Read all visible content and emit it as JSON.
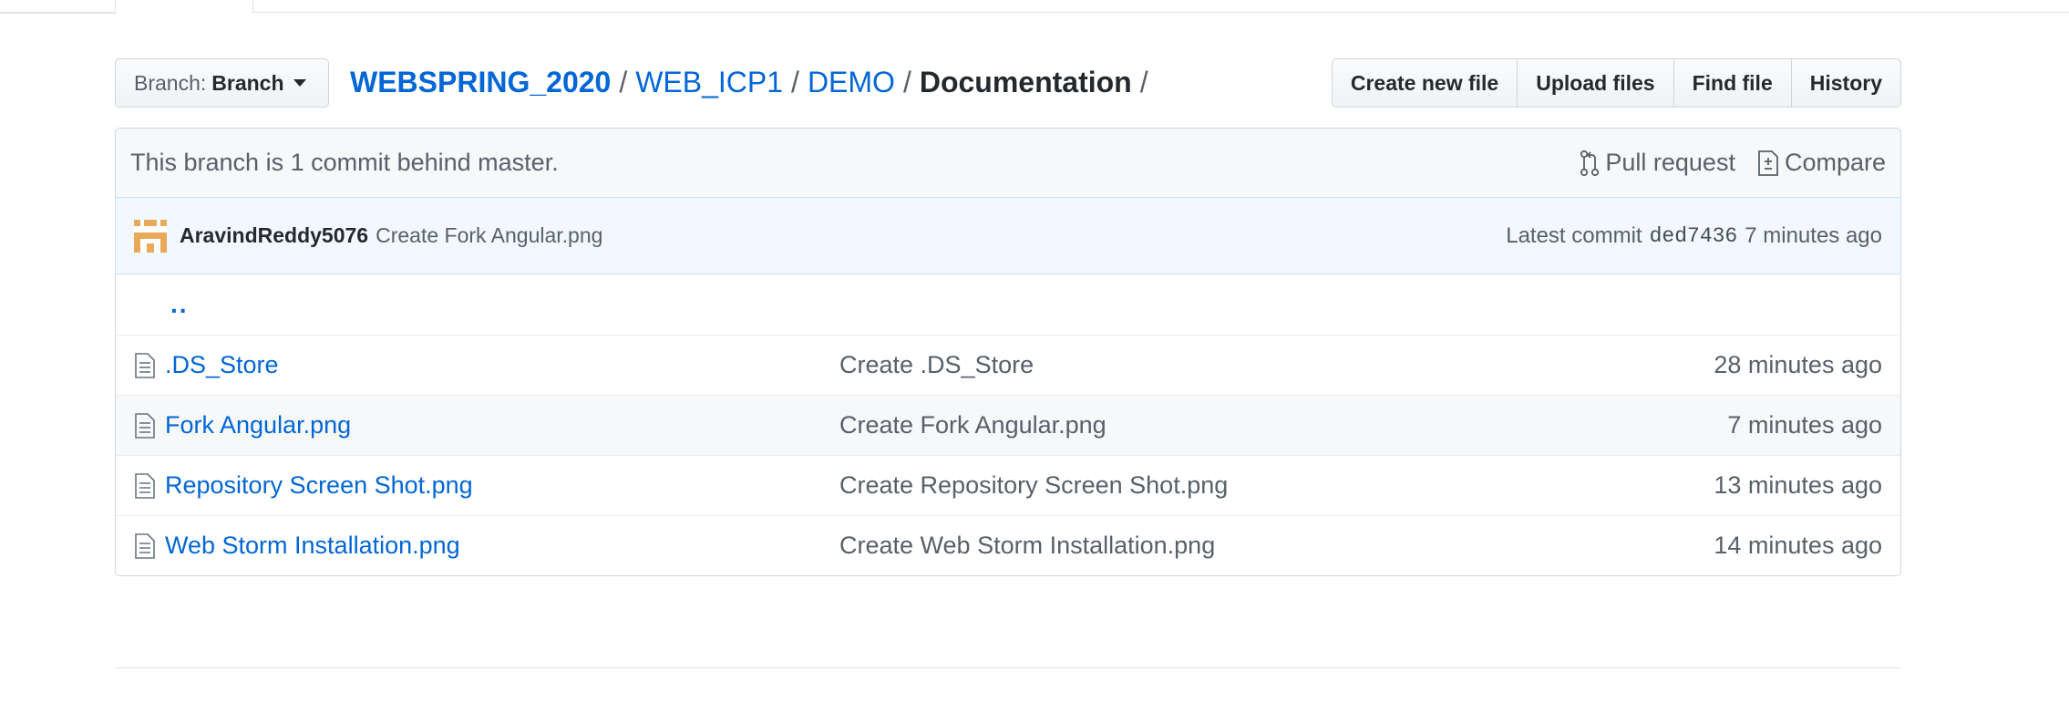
{
  "branch": {
    "prefix": "Branch:",
    "value": "Branch"
  },
  "breadcrumb": {
    "root": "WEBSPRING_2020",
    "parts": [
      "WEB_ICP1",
      "DEMO"
    ],
    "current": "Documentation",
    "separator": "/"
  },
  "actions": {
    "create_new_file": "Create new file",
    "upload_files": "Upload files",
    "find_file": "Find file",
    "history": "History"
  },
  "branch_info": {
    "message": "This branch is 1 commit behind master.",
    "pull_request": "Pull request",
    "compare": "Compare"
  },
  "commit": {
    "author": "AravindReddy5076",
    "message": "Create Fork Angular.png",
    "latest_label": "Latest commit",
    "sha": "ded7436",
    "age": "7 minutes ago"
  },
  "up_link": "..",
  "files": [
    {
      "name": ".DS_Store",
      "message": "Create .DS_Store",
      "age": "28 minutes ago"
    },
    {
      "name": "Fork Angular.png",
      "message": "Create Fork Angular.png",
      "age": "7 minutes ago"
    },
    {
      "name": "Repository Screen Shot.png",
      "message": "Create Repository Screen Shot.png",
      "age": "13 minutes ago"
    },
    {
      "name": "Web Storm Installation.png",
      "message": "Create Web Storm Installation.png",
      "age": "14 minutes ago"
    }
  ],
  "colors": {
    "link": "#0366d6",
    "muted": "#586069",
    "commit_bg": "#f1f8ff",
    "avatar": "#e8a958"
  }
}
